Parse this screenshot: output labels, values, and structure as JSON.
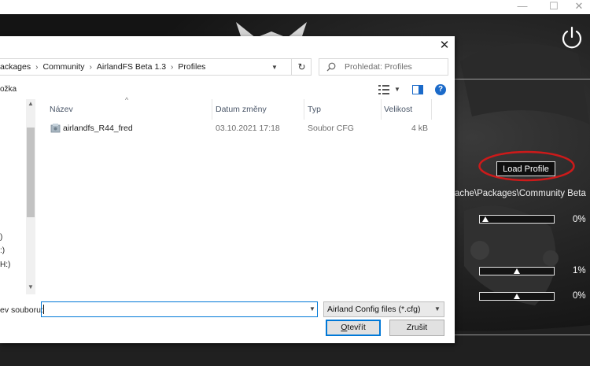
{
  "background_app": {
    "window_controls": {
      "minimize": "—",
      "maximize": "☐",
      "close": "✕"
    },
    "load_profile_label": "Load Profile",
    "path_text": "ache\\Packages\\Community Beta",
    "sliders": [
      {
        "value": 0.03,
        "percent_label": "0%"
      },
      {
        "value": 0.5,
        "percent_label": "1%"
      },
      {
        "value": 0.5,
        "percent_label": "0%"
      }
    ],
    "annotation_color": "#cc1a1a"
  },
  "dialog": {
    "close_glyph": "✕",
    "breadcrumb": [
      "ackages",
      "Community",
      "AirlandFS Beta 1.3",
      "Profiles"
    ],
    "breadcrumb_sep": "›",
    "refresh_glyph": "↻",
    "search_placeholder": "Prohledat: Profiles",
    "toolbar_new_folder": "ožka",
    "help_glyph": "?",
    "nav_drives": [
      ")",
      ":)",
      "H:)"
    ],
    "columns": {
      "name": "Název",
      "date": "Datum změny",
      "type": "Typ",
      "size": "Velikost"
    },
    "sort_caret": "^",
    "files": [
      {
        "name": "airlandfs_R44_fred",
        "date": "03.10.2021 17:18",
        "type": "Soubor CFG",
        "size": "4 kB"
      }
    ],
    "filename_label": "ev souboru:",
    "filename_value": "",
    "filetype_selected": "Airland Config files (*.cfg)",
    "open_button_underlined": "O",
    "open_button_rest": "tevřít",
    "cancel_button": "Zrušit",
    "accent_color": "#0078d7"
  }
}
